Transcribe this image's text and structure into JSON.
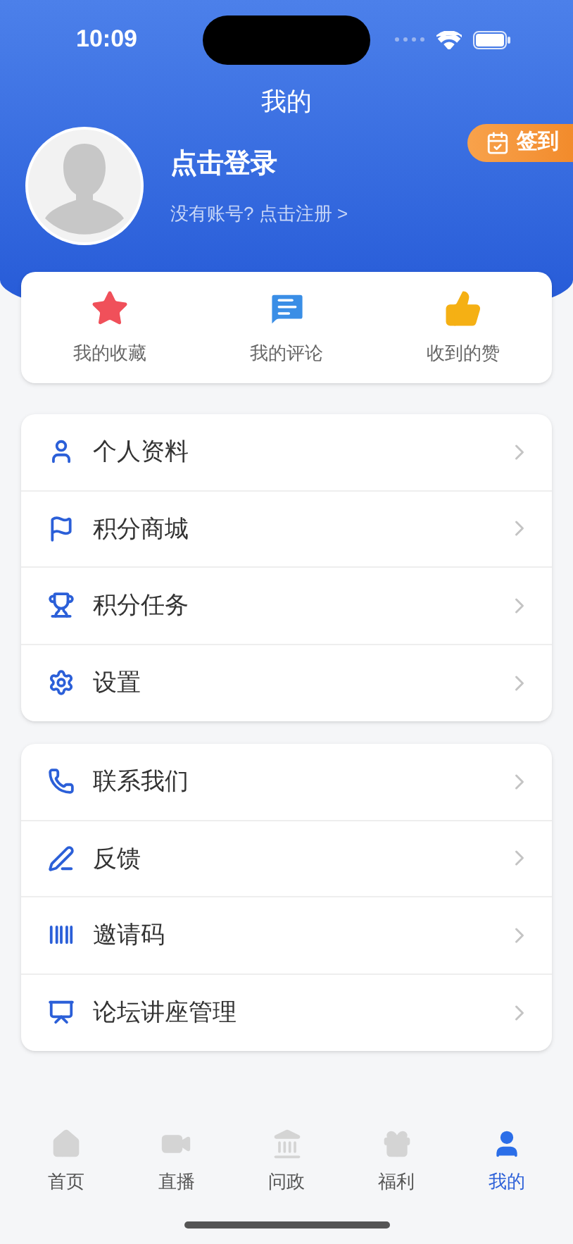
{
  "status_bar": {
    "time": "10:09"
  },
  "header": {
    "title": "我的",
    "login": "点击登录",
    "register": "没有账号? 点击注册 >",
    "checkin": "签到"
  },
  "quick": [
    {
      "label": "我的收藏"
    },
    {
      "label": "我的评论"
    },
    {
      "label": "收到的赞"
    }
  ],
  "menu_groups": [
    [
      {
        "label": "个人资料"
      },
      {
        "label": "积分商城"
      },
      {
        "label": "积分任务"
      },
      {
        "label": "设置"
      }
    ],
    [
      {
        "label": "联系我们"
      },
      {
        "label": "反馈"
      },
      {
        "label": "邀请码"
      },
      {
        "label": "论坛讲座管理"
      }
    ]
  ],
  "tab_bar": [
    {
      "label": "首页",
      "selected": false
    },
    {
      "label": "直播",
      "selected": false
    },
    {
      "label": "问政",
      "selected": false
    },
    {
      "label": "福利",
      "selected": false
    },
    {
      "label": "我的",
      "selected": true
    }
  ]
}
